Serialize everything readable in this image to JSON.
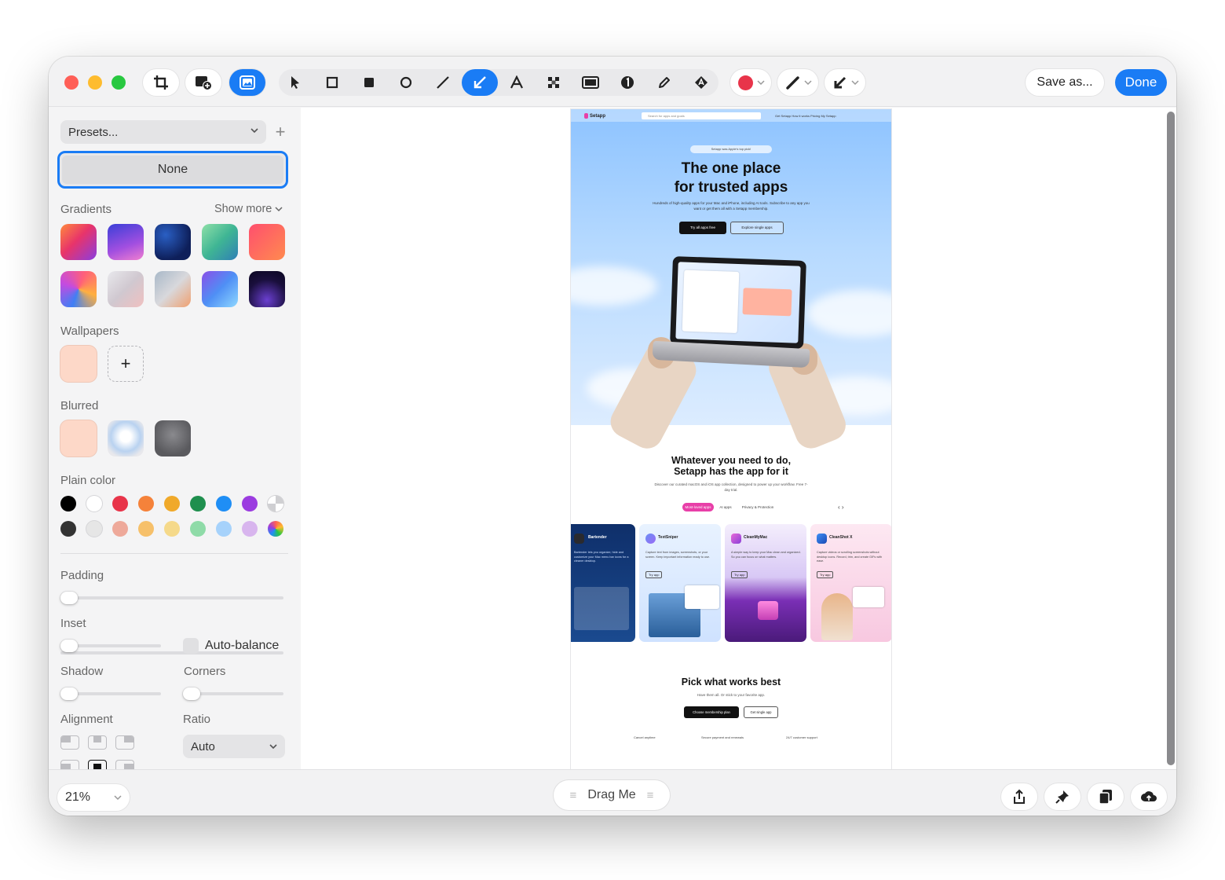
{
  "toolbar": {
    "save_label": "Save as...",
    "done_label": "Done"
  },
  "colors": {
    "accent": "#1a7cf5",
    "selected_color": "#e8344a",
    "close": "#ff5f57",
    "minimize": "#febc2e",
    "maximize": "#28c840"
  },
  "sidebar": {
    "presets_label": "Presets...",
    "none_label": "None",
    "gradients_label": "Gradients",
    "show_more_label": "Show more",
    "wallpapers_label": "Wallpapers",
    "blurred_label": "Blurred",
    "plain_color_label": "Plain color",
    "padding_label": "Padding",
    "inset_label": "Inset",
    "auto_balance_label": "Auto-balance",
    "shadow_label": "Shadow",
    "corners_label": "Corners",
    "alignment_label": "Alignment",
    "ratio_label": "Ratio",
    "ratio_value": "Auto",
    "gradient_swatches": [
      "#ff4f6e",
      "#7f3fd8",
      "#102f7a",
      "#3fbf94",
      "#ff6a4f",
      "#d14bd6",
      "#d8d8dc",
      "#e8a07a",
      "#6a7df5",
      "#1a0f3d"
    ],
    "plain_colors_row1": [
      "#000000",
      "#ffffff",
      "#e8344a",
      "#f5823a",
      "#f0a92a",
      "#1f8f4e",
      "#1f8ef5",
      "#9b3ce0"
    ],
    "plain_colors_row2": [
      "#333333",
      "#e6e6e6",
      "#eea99a",
      "#f6c06a",
      "#f5d98a",
      "#8fdba8",
      "#a6d2fb",
      "#d8b5ee"
    ]
  },
  "preview": {
    "nav_logo": "Setapp",
    "nav_search": "Search for apps and goals",
    "nav_links": "Get Setapp   How it works   Pricing   My Setapp",
    "hero_badge": "Setapp was Apple's top pick!",
    "hero_title_line1": "The one place",
    "hero_title_line2": "for trusted apps",
    "hero_sub": "Hundreds of high-quality apps for your Mac and iPhone, including AI tools. Subscribe to any app you want or get them all with a Setapp membership.",
    "hero_btn1": "Try all apps free",
    "hero_btn2": "Explore single apps",
    "sec2_title_line1": "Whatever you need to do,",
    "sec2_title_line2": "Setapp has the app for it",
    "sec2_sub": "Discover our curated macOS and iOS app collection, designed to power up your workflow. Free 7-day trial.",
    "chips": [
      "Most-loved apps",
      "AI apps",
      "Privacy & Protection"
    ],
    "cards": [
      {
        "title": "Bartender",
        "body": "Bartender lets you organize, hide and customize your Mac menu bar icons for a cleaner desktop."
      },
      {
        "title": "TextSniper",
        "body": "Capture text from images, screenshots, or your screen. Keep important information ready to use."
      },
      {
        "title": "CleanMyMac",
        "body": "A simple way to keep your Mac clean and organized. So you can focus on what matters."
      },
      {
        "title": "CleanShot X",
        "body": "Capture videos or scrolling screenshots without desktop icons. Record, trim, and create GIFs with ease."
      }
    ],
    "card_cta": "Try app",
    "sec3_title": "Pick what works best",
    "sec3_sub": "Have them all. Or stick to your favorite app.",
    "sec3_btn1": "Choose membership plan",
    "sec3_btn2": "Get single app",
    "features": [
      "Cancel anytime",
      "Secure payment and renewals",
      "24/7 customer support"
    ]
  },
  "bottom": {
    "zoom": "21%",
    "drag_label": "Drag Me"
  }
}
